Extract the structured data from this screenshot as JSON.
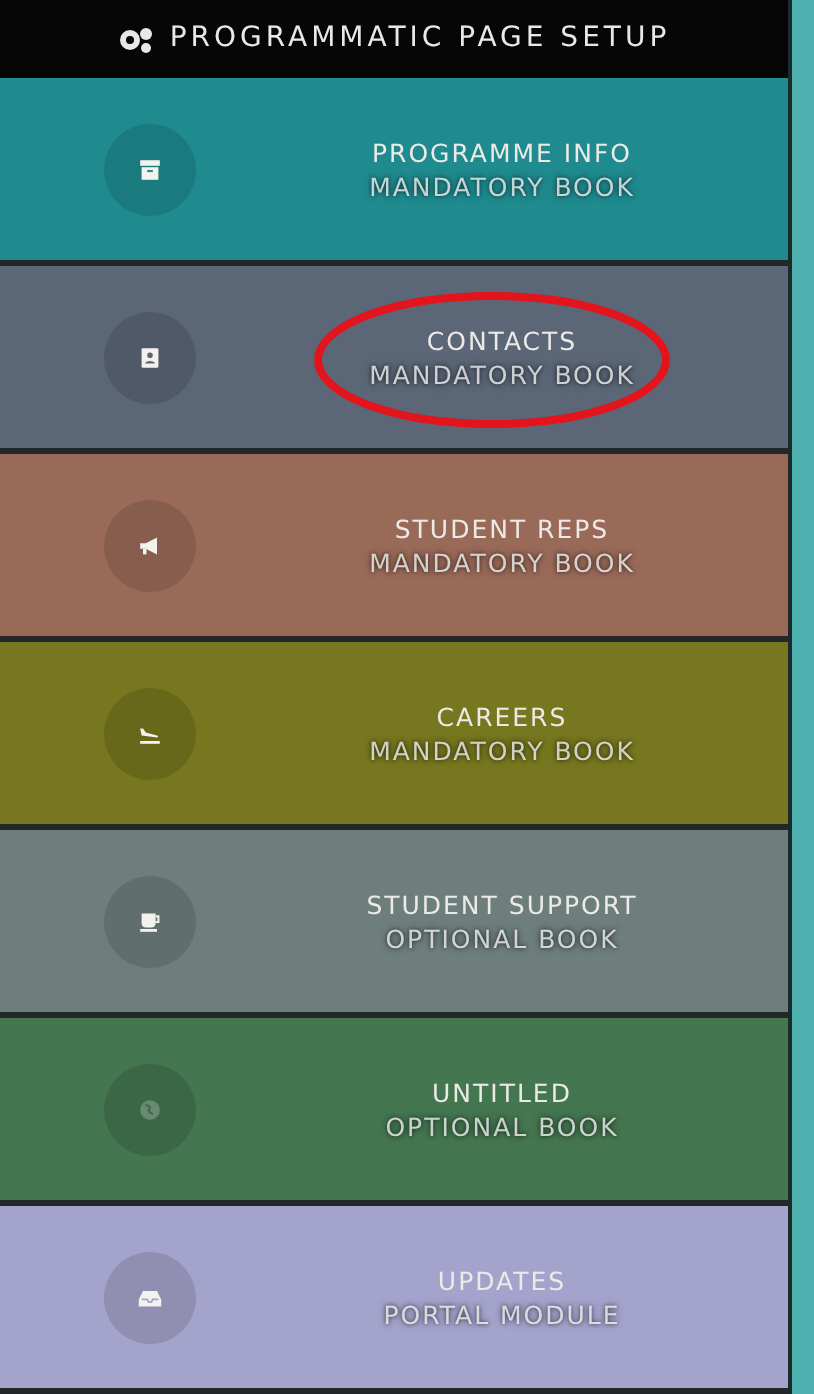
{
  "header": {
    "title": "PROGRAMMATIC PAGE SETUP"
  },
  "items": [
    {
      "title": "PROGRAMME INFO",
      "subtitle": "MANDATORY BOOK",
      "color": "#1f8b8f",
      "disabled": false,
      "highlighted": false
    },
    {
      "title": "CONTACTS",
      "subtitle": "MANDATORY BOOK",
      "color": "#5b6677",
      "disabled": false,
      "highlighted": true
    },
    {
      "title": "STUDENT REPS",
      "subtitle": "MANDATORY BOOK",
      "color": "#9a6a59",
      "disabled": false,
      "highlighted": false
    },
    {
      "title": "CAREERS",
      "subtitle": "MANDATORY BOOK",
      "color": "#76771e",
      "disabled": false,
      "highlighted": false
    },
    {
      "title": "STUDENT SUPPORT",
      "subtitle": "OPTIONAL BOOK",
      "color": "#6e7e7d",
      "disabled": false,
      "highlighted": false
    },
    {
      "title": "UNTITLED",
      "subtitle": "OPTIONAL BOOK",
      "color": "#447650",
      "disabled": true,
      "highlighted": false
    },
    {
      "title": "UPDATES",
      "subtitle": "PORTAL MODULE",
      "color": "#a4a3cb",
      "disabled": false,
      "highlighted": false
    }
  ]
}
